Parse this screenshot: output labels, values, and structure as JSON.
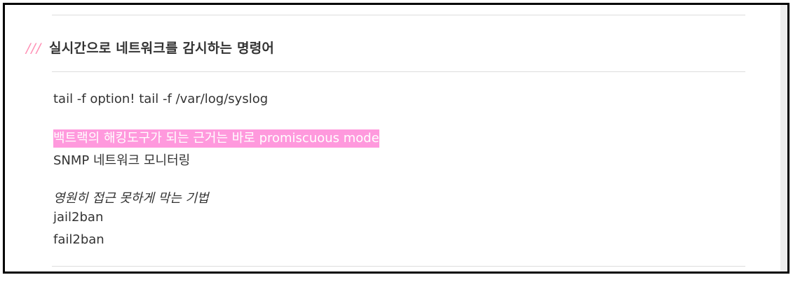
{
  "section": {
    "heading_prefix": "///",
    "heading_text": "실시간으로 네트워크를 감시하는 명령어"
  },
  "body": {
    "line1": "tail -f option! tail -f /var/log/syslog",
    "line2_highlighted": "백트랙의 해킹도구가 되는 근거는 바로 promiscuous mode",
    "line3": "SNMP 네트워크 모니터링",
    "line4_italic": "영원히 접근 못하게 막는 기법",
    "line5": "jail2ban",
    "line6": "fail2ban"
  },
  "colors": {
    "accent_slashes": "#ff8fb4",
    "highlight_background": "#ff99dd",
    "highlight_text": "#ffffff",
    "body_text": "#333333",
    "rule": "#dddddd"
  }
}
